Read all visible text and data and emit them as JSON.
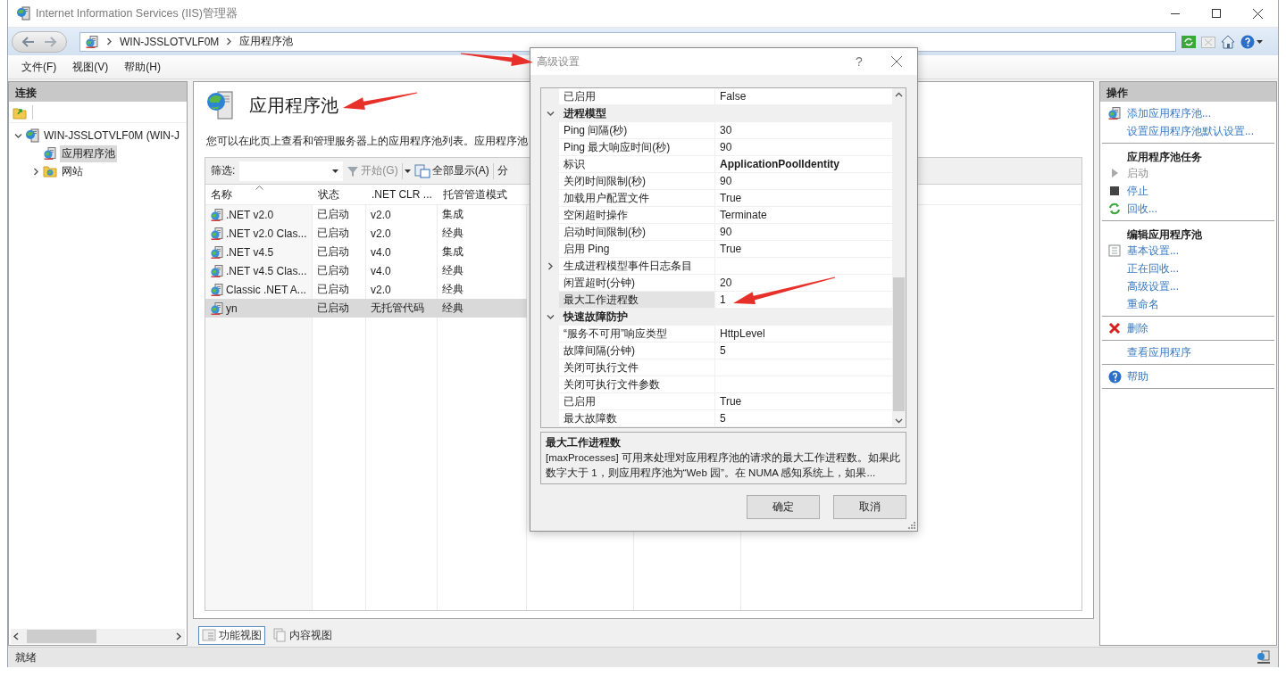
{
  "window": {
    "title": "Internet Information Services (IIS)管理器"
  },
  "address_bar": {
    "breadcrumbs": [
      "WIN-JSSLOTVLF0M",
      "应用程序池"
    ]
  },
  "menu": [
    "文件(F)",
    "视图(V)",
    "帮助(H)"
  ],
  "connections": {
    "title": "连接",
    "tree": [
      {
        "label": "WIN-JSSLOTVLF0M (WIN-J",
        "selected": false,
        "expanded": true,
        "children": [
          {
            "label": "应用程序池",
            "selected": true
          },
          {
            "label": "网站",
            "selected": false,
            "expanded": false
          }
        ]
      }
    ]
  },
  "page": {
    "title": "应用程序池",
    "description": "您可以在此页上查看和管理服务器上的应用程序池列表。应用程序池",
    "toolbar": {
      "filter_label": "筛选:",
      "buttons": [
        {
          "label": "开始(G)",
          "disabled": true
        },
        {
          "label": "全部显示(A)",
          "disabled": false
        },
        {
          "label": "分",
          "disabled": false
        }
      ]
    },
    "table": {
      "columns": [
        {
          "label": "名称",
          "sorted": true
        },
        {
          "label": "状态",
          "sorted": false
        },
        {
          "label": ".NET CLR ...",
          "sorted": false
        },
        {
          "label": "托管管道模式",
          "sorted": false
        }
      ],
      "rows": [
        {
          "cells": [
            ".NET v2.0",
            "已启动",
            "v2.0",
            "集成"
          ],
          "selected": false
        },
        {
          "cells": [
            ".NET v2.0 Clas...",
            "已启动",
            "v2.0",
            "经典"
          ],
          "selected": false
        },
        {
          "cells": [
            ".NET v4.5",
            "已启动",
            "v4.0",
            "集成"
          ],
          "selected": false
        },
        {
          "cells": [
            ".NET v4.5 Clas...",
            "已启动",
            "v4.0",
            "经典"
          ],
          "selected": false
        },
        {
          "cells": [
            "Classic .NET A...",
            "已启动",
            "v2.0",
            "经典"
          ],
          "selected": false
        },
        {
          "cells": [
            "yn",
            "已启动",
            "无托管代码",
            "经典"
          ],
          "selected": true
        }
      ]
    }
  },
  "view_tabs": [
    {
      "label": "功能视图",
      "selected": true
    },
    {
      "label": "内容视图",
      "selected": false
    }
  ],
  "actions": {
    "title": "操作",
    "groups": [
      {
        "items": [
          {
            "label": "添加应用程序池...",
            "disabled": false
          },
          {
            "label": "设置应用程序池默认设置...",
            "disabled": false
          }
        ]
      },
      {
        "heading": "应用程序池任务",
        "items": [
          {
            "label": "启动",
            "disabled": true
          },
          {
            "label": "停止",
            "disabled": false
          },
          {
            "label": "回收...",
            "disabled": false
          }
        ]
      },
      {
        "heading": "编辑应用程序池",
        "items": [
          {
            "label": "基本设置...",
            "disabled": false
          },
          {
            "label": "正在回收...",
            "disabled": false
          },
          {
            "label": "高级设置...",
            "disabled": false
          },
          {
            "label": "重命名",
            "disabled": false
          }
        ]
      },
      {
        "items": [
          {
            "label": "删除",
            "disabled": false
          }
        ]
      },
      {
        "items": [
          {
            "label": "查看应用程序",
            "disabled": false
          }
        ]
      },
      {
        "items": [
          {
            "label": "帮助",
            "disabled": false
          }
        ]
      }
    ]
  },
  "status_bar": {
    "text": "就绪"
  },
  "dialog": {
    "title": "高级设置",
    "help_button": "?",
    "properties": [
      {
        "kind": "property",
        "name": "已启用",
        "value": "False",
        "selected": false
      },
      {
        "kind": "category",
        "name": "进程模型",
        "expanded": true
      },
      {
        "kind": "property",
        "name": "Ping 间隔(秒)",
        "value": "30",
        "selected": false
      },
      {
        "kind": "property",
        "name": "Ping 最大响应时间(秒)",
        "value": "90",
        "selected": false
      },
      {
        "kind": "property",
        "name": "标识",
        "value": "ApplicationPoolIdentity",
        "bold": true,
        "selected": false
      },
      {
        "kind": "property",
        "name": "关闭时间限制(秒)",
        "value": "90",
        "selected": false
      },
      {
        "kind": "property",
        "name": "加载用户配置文件",
        "value": "True",
        "selected": false
      },
      {
        "kind": "property",
        "name": "空闲超时操作",
        "value": "Terminate",
        "selected": false
      },
      {
        "kind": "property",
        "name": "启动时间限制(秒)",
        "value": "90",
        "selected": false
      },
      {
        "kind": "property",
        "name": "启用 Ping",
        "value": "True",
        "selected": false
      },
      {
        "kind": "expandable",
        "name": "生成进程模型事件日志条目",
        "expanded": false,
        "selected": false
      },
      {
        "kind": "property",
        "name": "闲置超时(分钟)",
        "value": "20",
        "selected": false
      },
      {
        "kind": "property",
        "name": "最大工作进程数",
        "value": "1",
        "selected": true
      },
      {
        "kind": "category",
        "name": "快速故障防护",
        "expanded": true
      },
      {
        "kind": "property",
        "name": "“服务不可用”响应类型",
        "value": "HttpLevel",
        "selected": false
      },
      {
        "kind": "property",
        "name": "故障间隔(分钟)",
        "value": "5",
        "selected": false
      },
      {
        "kind": "property",
        "name": "关闭可执行文件",
        "selected": false
      },
      {
        "kind": "property",
        "name": "关闭可执行文件参数",
        "selected": false
      },
      {
        "kind": "property",
        "name": "已启用",
        "value": "True",
        "selected": false
      },
      {
        "kind": "property",
        "name": "最大故障数",
        "value": "5",
        "selected": false
      }
    ],
    "description": {
      "title": "最大工作进程数",
      "text": "[maxProcesses] 可用来处理对应用程序池的请求的最大工作进程数。如果此数字大于 1，则应用程序池为“Web 园”。在 NUMA 感知系统上，如果..."
    },
    "buttons": [
      "确定",
      "取消"
    ]
  }
}
